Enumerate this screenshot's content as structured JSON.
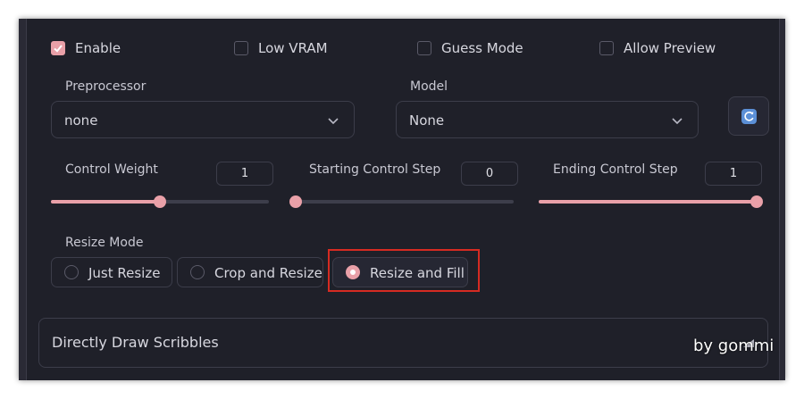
{
  "options": {
    "enable": {
      "label": "Enable",
      "checked": true
    },
    "low_vram": {
      "label": "Low VRAM",
      "checked": false
    },
    "guess_mode": {
      "label": "Guess Mode",
      "checked": false
    },
    "allow_preview": {
      "label": "Allow Preview",
      "checked": false
    }
  },
  "preprocessor": {
    "label": "Preprocessor",
    "value": "none"
  },
  "model": {
    "label": "Model",
    "value": "None"
  },
  "sliders": {
    "control_weight": {
      "label": "Control Weight",
      "value": "1",
      "fraction": 0.5
    },
    "starting_step": {
      "label": "Starting Control Step",
      "value": "0",
      "fraction": 0.0
    },
    "ending_step": {
      "label": "Ending Control Step",
      "value": "1",
      "fraction": 1.0
    }
  },
  "resize_mode": {
    "label": "Resize Mode",
    "options": [
      "Just Resize",
      "Crop and Resize",
      "Resize and Fill"
    ],
    "selected": "Resize and Fill"
  },
  "accordion": {
    "title": "Directly Draw Scribbles"
  },
  "watermark": "by gommi",
  "colors": {
    "accent": "#e9a0a8",
    "highlight_box": "#d62b22",
    "background": "#1f2029"
  }
}
